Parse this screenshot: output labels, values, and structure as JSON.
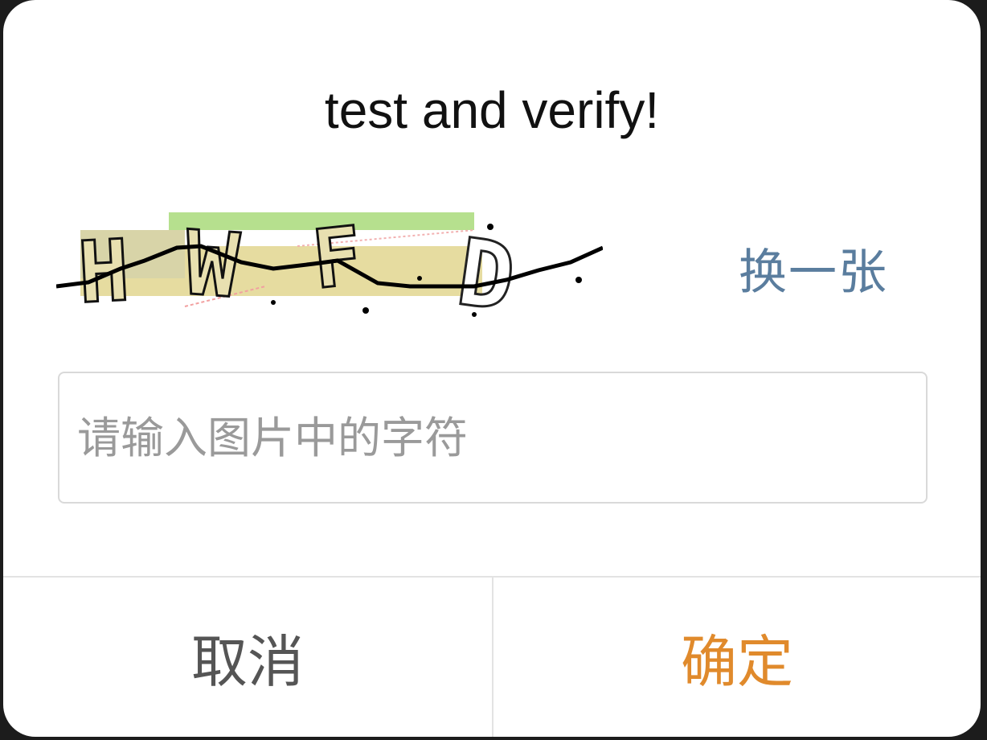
{
  "dialog": {
    "title": "test and verify!",
    "captcha": {
      "refresh_label": "换一张",
      "refresh_color": "#5a7d9e",
      "characters": "HWFD"
    },
    "input": {
      "placeholder": "请输入图片中的字符",
      "value": ""
    },
    "buttons": {
      "cancel_label": "取消",
      "confirm_label": "确定",
      "confirm_color": "#e08a2c"
    }
  }
}
